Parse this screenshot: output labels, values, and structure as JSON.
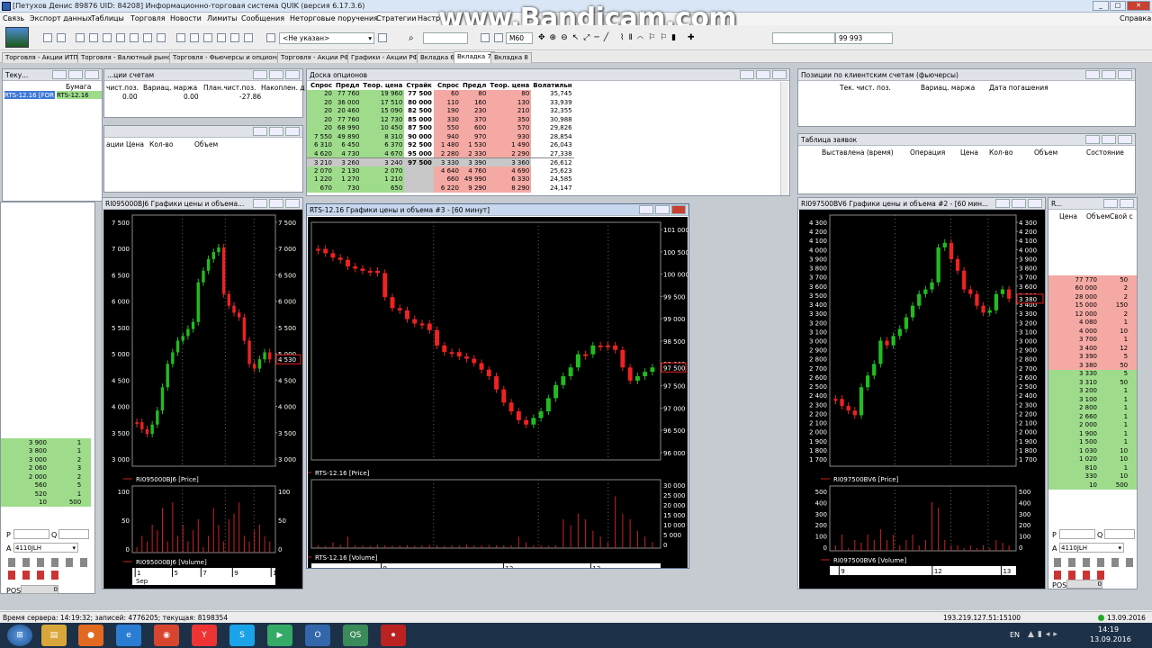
{
  "window": {
    "title": "[Петухов Денис 89876 UID: 84208] Информационно-торговая система QUIK (версия 6.17.3.6)",
    "help": "Справка"
  },
  "menu": [
    "Связь",
    "Экспорт данных",
    "Таблицы",
    "Торговля",
    "Новости",
    "Лимиты",
    "Сообщения",
    "Неторговые поручения",
    "Стратегии",
    "Настр"
  ],
  "toolbar": {
    "account_combo": "<Не указан>",
    "interval": "M60",
    "value_field": "99 993"
  },
  "tabs": [
    "Торговля - Акции ИТП",
    "Торговля - Валютный рынок",
    "Торговля - Фьючерсы и опционы",
    "Торговля - Акции РФ",
    "Графики - Акции РФ",
    "Вкладка 6",
    "Вкладка 7",
    "Вкладка 8"
  ],
  "watermark": "www.Bandicam.com",
  "left_top_panel": {
    "title": "Теку...",
    "headers": [
      "Бумага",
      "чист.поз.",
      "Вариац. маржа",
      "План.чист.поз.",
      "Накоплен. д"
    ],
    "row": [
      "RTS-12.16 [FOR",
      "RTS-12.16",
      "0.00",
      "0.00",
      "-27.86"
    ],
    "second_title": "...ции счетам"
  },
  "orders_panel_headers": [
    "ации",
    "Цена",
    "Кол-во",
    "Объем"
  ],
  "left_orderbook": {
    "rows": [
      [
        "3 900",
        "1"
      ],
      [
        "3 800",
        "1"
      ],
      [
        "3 000",
        "2"
      ],
      [
        "2 060",
        "3"
      ],
      [
        "2 000",
        "2"
      ],
      [
        "560",
        "5"
      ],
      [
        "520",
        "1"
      ],
      [
        "10",
        "500"
      ]
    ]
  },
  "left_controls": {
    "p_label": "P",
    "q_label": "Q",
    "account": "4110JLH",
    "pos_label": "POS",
    "pos_value": "0"
  },
  "option_board": {
    "title": "Доска опционов",
    "headers": [
      "Спрос",
      "Предл",
      "Теор. цена",
      "Страйк",
      "Спрос",
      "Предл",
      "Теор. цена",
      "Волатильн"
    ],
    "rows": [
      [
        "20",
        "77 760",
        "19 960",
        "77 500",
        "60",
        "80",
        "80",
        "35,745"
      ],
      [
        "20",
        "36 000",
        "17 510",
        "80 000",
        "110",
        "160",
        "130",
        "33,939"
      ],
      [
        "20",
        "20 460",
        "15 090",
        "82 500",
        "190",
        "230",
        "210",
        "32,355"
      ],
      [
        "20",
        "77 760",
        "12 730",
        "85 000",
        "330",
        "370",
        "350",
        "30,988"
      ],
      [
        "20",
        "68 990",
        "10 450",
        "87 500",
        "550",
        "600",
        "570",
        "29,826"
      ],
      [
        "7 550",
        "49 890",
        "8 310",
        "90 000",
        "940",
        "970",
        "930",
        "28,854"
      ],
      [
        "6 310",
        "6 450",
        "6 370",
        "92 500",
        "1 480",
        "1 530",
        "1 490",
        "26,043"
      ],
      [
        "4 620",
        "4 730",
        "4 670",
        "95 000",
        "2 280",
        "2 330",
        "2 290",
        "27,338"
      ],
      [
        "3 210",
        "3 260",
        "3 240",
        "97 500",
        "3 330",
        "3 390",
        "3 360",
        "26,612"
      ],
      [
        "2 070",
        "2 130",
        "2 070",
        "",
        "4 640",
        "4 760",
        "4 690",
        "25,623"
      ],
      [
        "1 220",
        "1 270",
        "1 210",
        "",
        "660",
        "49 990",
        "6 330",
        "24,585"
      ],
      [
        "670",
        "730",
        "650",
        "",
        "6 220",
        "9 290",
        "8 290",
        "24,147"
      ]
    ]
  },
  "positions_panel": {
    "title": "Позиции по клиентским счетам (фьючерсы)",
    "headers": [
      "Тек. чист. поз.",
      "Вариац. маржа",
      "Дата погашения"
    ]
  },
  "orders_table": {
    "title": "Таблица заявок",
    "headers": [
      "Выставлена (время)",
      "Операция",
      "Цена",
      "Кол-во",
      "Объем",
      "Состояние"
    ]
  },
  "chart_left": {
    "title": "RI095000BJ6 Графики цены и объема...",
    "price_ticks": [
      "7 500",
      "7 000",
      "6 500",
      "6 000",
      "5 500",
      "5 000",
      "4 500",
      "4 000",
      "3 500",
      "3 000"
    ],
    "last_price": "4 530",
    "price_legend": "RI095000BJ6 [Price]",
    "vol_ticks": [
      "100",
      "50",
      "0"
    ],
    "vol_legend": "RI095000BJ6 [Volume]",
    "dates": [
      "1",
      "5",
      "7",
      "9",
      "13"
    ],
    "month": "Sep"
  },
  "chart_center": {
    "title": "RTS-12.16 Графики цены и объема #3 - [60 минут]",
    "price_ticks": [
      "101 000",
      "100 500",
      "100 000",
      "99 500",
      "99 000",
      "98 500",
      "98 000",
      "97 500",
      "97 000",
      "96 500",
      "96 000"
    ],
    "last_price": "97 500",
    "price_legend": "RTS-12.16 [Price]",
    "vol_ticks": [
      "30 000",
      "25 000",
      "20 000",
      "15 000",
      "10 000",
      "5 000",
      "0"
    ],
    "vol_legend": "RTS-12.16 [Volume]",
    "dates": [
      "9",
      "12",
      "13"
    ]
  },
  "chart_right": {
    "title": "RI097500BV6 Графики цены и объема #2 - [60 мин...",
    "price_ticks": [
      "4 300",
      "4 200",
      "4 100",
      "4 000",
      "3 900",
      "3 800",
      "3 700",
      "3 600",
      "3 500",
      "3 400",
      "3 300",
      "3 200",
      "3 100",
      "3 000",
      "2 900",
      "2 800",
      "2 700",
      "2 600",
      "2 500",
      "2 400",
      "2 300",
      "2 200",
      "2 100",
      "2 000",
      "1 900",
      "1 800",
      "1 700"
    ],
    "last_price": "3 380",
    "price_legend": "RI097500BV6 [Price]",
    "vol_ticks": [
      "500",
      "400",
      "300",
      "200",
      "100",
      "0"
    ],
    "vol_legend": "RI097500BV6 [Volume]",
    "dates": [
      "9",
      "12",
      "13"
    ]
  },
  "right_orderbook": {
    "title": "R...",
    "headers": [
      "Цена",
      "Объем",
      "Свой с"
    ],
    "sell": [
      [
        "77 770",
        "50"
      ],
      [
        "60 000",
        "2"
      ],
      [
        "28 000",
        "2"
      ],
      [
        "15 000",
        "150"
      ],
      [
        "12 000",
        "2"
      ],
      [
        "4 080",
        "1"
      ],
      [
        "4 000",
        "10"
      ],
      [
        "3 700",
        "1"
      ],
      [
        "3 400",
        "12"
      ],
      [
        "3 390",
        "5"
      ],
      [
        "3 380",
        "50"
      ]
    ],
    "buy": [
      [
        "3 330",
        "5"
      ],
      [
        "3 310",
        "50"
      ],
      [
        "3 200",
        "1"
      ],
      [
        "3 100",
        "1"
      ],
      [
        "2 800",
        "1"
      ],
      [
        "2 660",
        "1"
      ],
      [
        "2 000",
        "1"
      ],
      [
        "1 900",
        "1"
      ],
      [
        "1 500",
        "1"
      ],
      [
        "1 030",
        "10"
      ],
      [
        "1 020",
        "10"
      ],
      [
        "810",
        "1"
      ],
      [
        "330",
        "10"
      ],
      [
        "10",
        "500"
      ]
    ],
    "account": "4110JLH",
    "pos_value": "0"
  },
  "status": {
    "server_time": "Время сервера: 14:19:32; записей: 4776205; текущая: 8198354",
    "connection": "193.219.127.51:15100",
    "date": "13.09.2016"
  },
  "taskbar": {
    "lang": "EN",
    "time": "14:19",
    "date": "13.09.2016"
  }
}
